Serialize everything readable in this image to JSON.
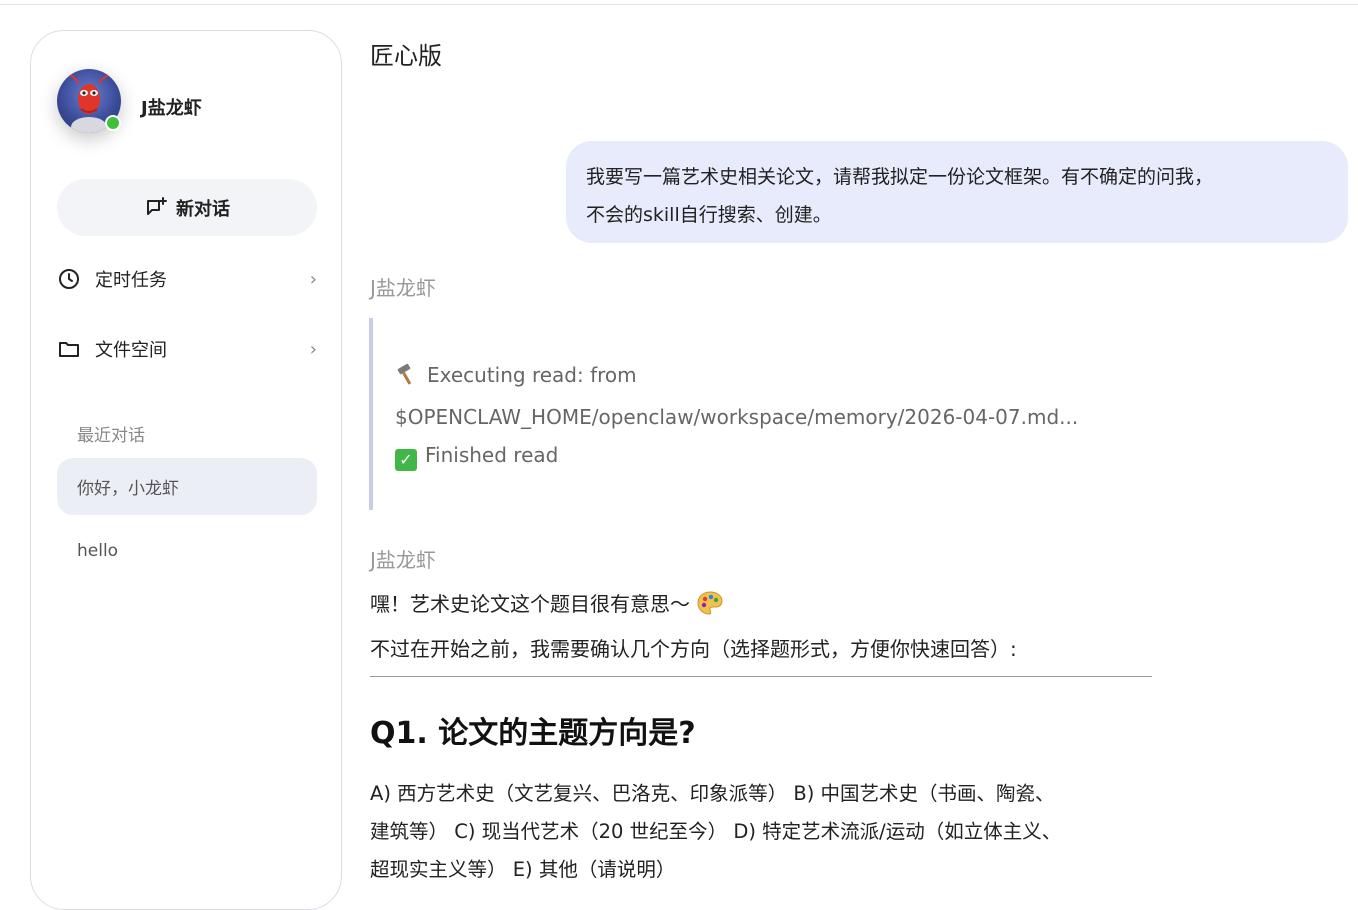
{
  "sidebar": {
    "user_name": "J盐龙虾",
    "new_chat_label": "新对话",
    "menu": [
      {
        "label": "定时任务",
        "icon": "clock-icon"
      },
      {
        "label": "文件空间",
        "icon": "folder-icon"
      }
    ],
    "recent_label": "最近对话",
    "recent": [
      {
        "label": "你好，小龙虾",
        "active": true
      },
      {
        "label": "hello",
        "active": false
      }
    ]
  },
  "main": {
    "title": "匠心版",
    "user_message_line1": "我要写一篇艺术史相关论文，请帮我拟定一份论文框架。有不确定的问我，",
    "user_message_line2": "不会的skill自行搜索、创建。",
    "bot_name": "J盐龙虾",
    "tool": {
      "executing_line1": "Executing read: from",
      "executing_line2": "$OPENCLAW_HOME/openclaw/workspace/memory/2026-04-07.md...",
      "finished": "Finished read"
    },
    "reply_line1": "嘿！艺术史论文这个题目很有意思～",
    "reply_line2": "不过在开始之前，我需要确认几个方向（选择题形式，方便你快速回答）:",
    "q1_heading": "Q1. 论文的主题方向是?",
    "q1_line1": "A) 西方艺术史（文艺复兴、巴洛克、印象派等） B) 中国艺术史（书画、陶瓷、",
    "q1_line2": "建筑等） C) 现当代艺术（20 世纪至今） D) 特定艺术流派/运动（如立体主义、",
    "q1_line3": "超现实主义等） E) 其他（请说明）"
  },
  "colors": {
    "accent_bubble": "#e8ebfb",
    "online": "#3fc03a",
    "quote_bar": "#c9cde8"
  }
}
